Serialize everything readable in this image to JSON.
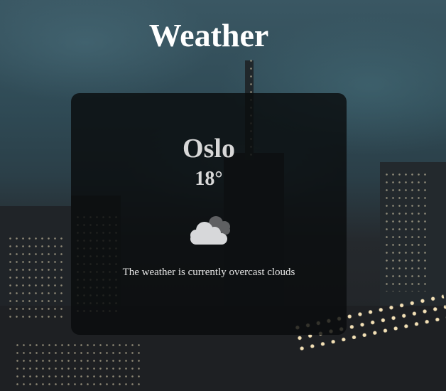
{
  "page": {
    "title": "Weather"
  },
  "weather": {
    "city": "Oslo",
    "temperature": "18°",
    "icon": "overcast-clouds-icon",
    "description": "The weather is currently overcast clouds"
  },
  "colors": {
    "card_background": "#0a0c0e",
    "text": "#ffffff",
    "muted_text": "#d8d8d8"
  }
}
